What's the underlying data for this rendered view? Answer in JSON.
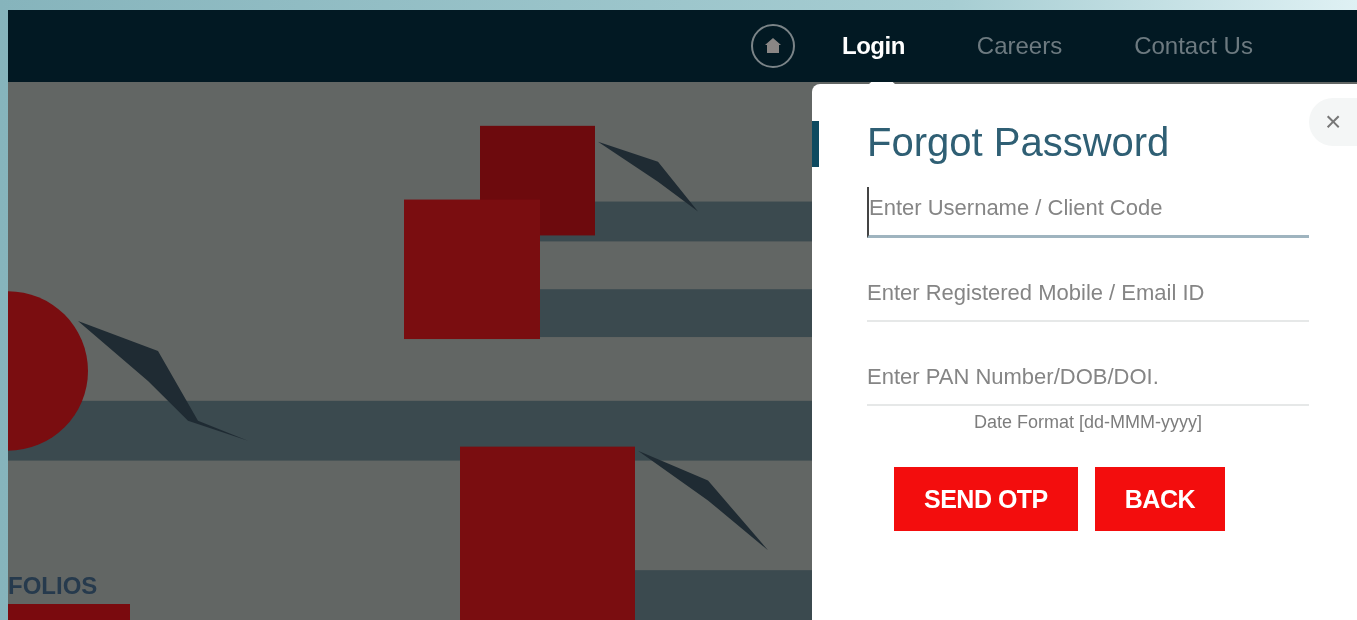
{
  "nav": {
    "items": [
      {
        "label": "Login",
        "selected": true
      },
      {
        "label": "Careers",
        "selected": false
      },
      {
        "label": "Contact Us",
        "selected": false
      }
    ]
  },
  "banner": {
    "kind": "picture",
    "caption": "FOLIOS"
  },
  "dialog": {
    "title": "Forgot Password",
    "close": "×",
    "fields": [
      {
        "placeholder": "Enter Username / Client Code",
        "focused": true
      },
      {
        "placeholder": "Enter Registered Mobile / Email ID",
        "focused": false
      },
      {
        "placeholder": "Enter PAN Number/DOB/DOI.",
        "focused": false
      }
    ],
    "hint": "Date Format [dd-MMM-yyyy]",
    "buttons": [
      "SEND OTP",
      "BACK"
    ]
  }
}
